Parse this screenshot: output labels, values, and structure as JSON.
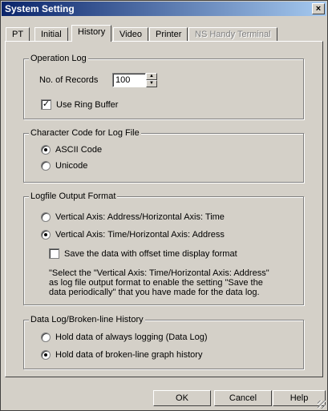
{
  "window": {
    "title": "System Setting",
    "close_glyph": "×"
  },
  "tabs": [
    {
      "label": "PT"
    },
    {
      "label": "Initial"
    },
    {
      "label": "History"
    },
    {
      "label": "Video"
    },
    {
      "label": "Printer"
    },
    {
      "label": "NS Handy Terminal"
    }
  ],
  "operation_log": {
    "title": "Operation Log",
    "records_label": "No. of Records",
    "records_value": "100",
    "ring_buffer_label": "Use Ring Buffer",
    "ring_buffer_checked": true
  },
  "char_code": {
    "title": "Character Code for Log File",
    "options": [
      {
        "label": "ASCII Code",
        "selected": true
      },
      {
        "label": "Unicode",
        "selected": false
      }
    ]
  },
  "output_format": {
    "title": "Logfile Output Format",
    "options": [
      {
        "label": "Vertical Axis: Address/Horizontal Axis: Time",
        "selected": false
      },
      {
        "label": "Vertical Axis: Time/Horizontal Axis: Address",
        "selected": true
      }
    ],
    "offset_label": "Save the data with offset time display format",
    "offset_checked": false,
    "note_lines": [
      "\"Select the \"Vertical Axis: Time/Horizontal Axis: Address\"",
      "as log file output format to enable the setting \"Save the",
      "data periodically\" that you have made for the data log."
    ]
  },
  "data_log": {
    "title": "Data Log/Broken-line History",
    "options": [
      {
        "label": "Hold data of always logging (Data Log)",
        "selected": false
      },
      {
        "label": "Hold data of broken-line graph history",
        "selected": true
      }
    ]
  },
  "buttons": {
    "ok": "OK",
    "cancel": "Cancel",
    "help": "Help"
  }
}
